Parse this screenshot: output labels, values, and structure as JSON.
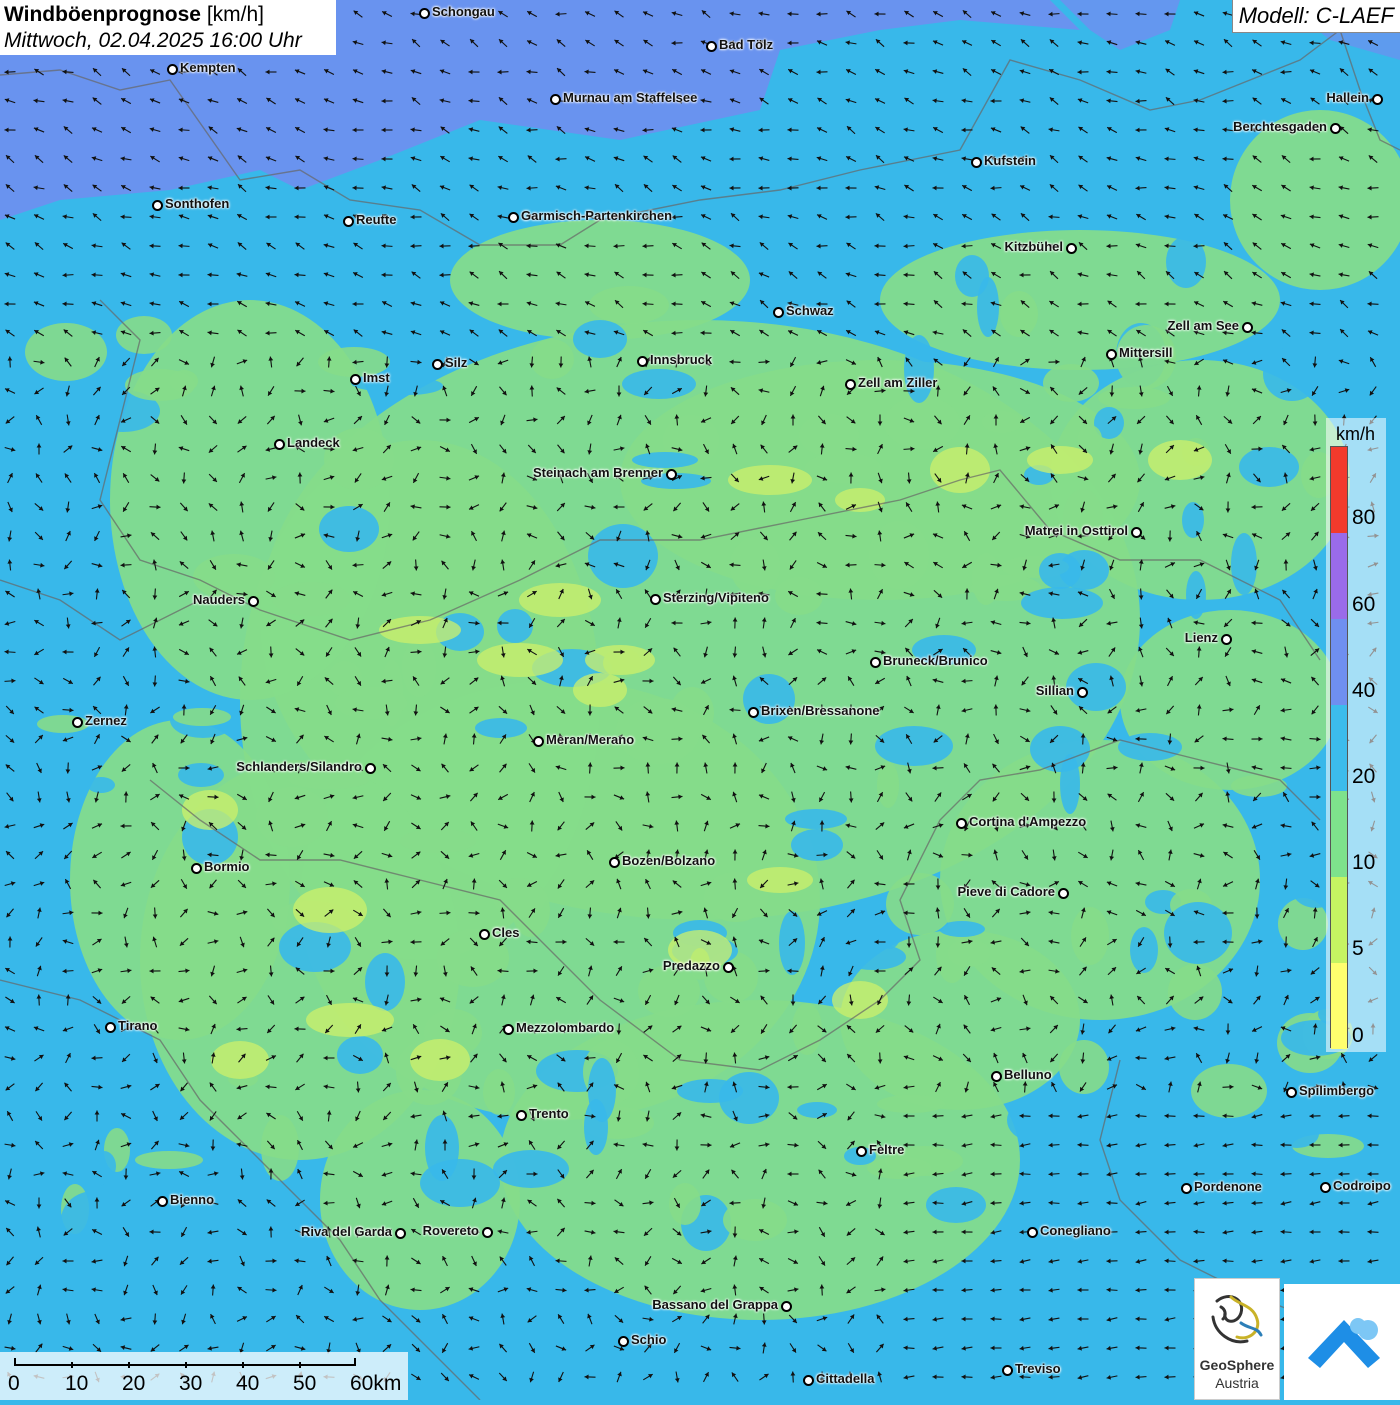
{
  "title": {
    "main_bold": "Windböenprognose",
    "unit": "[km/h]",
    "datetime": "Mittwoch, 02.04.2025 16:00 Uhr"
  },
  "model": "Modell: C-LAEF",
  "legend": {
    "unit": "km/h",
    "labels": [
      "80",
      "60",
      "40",
      "20",
      "10",
      "5",
      "0"
    ],
    "colors": [
      "#f23a2c",
      "#9a6bea",
      "#6f8ff0",
      "#3cbcec",
      "#7ee28c",
      "#c6f462",
      "#ffff6e"
    ]
  },
  "scalebar": {
    "labels": [
      "0",
      "10",
      "20",
      "30",
      "40",
      "50",
      "60km"
    ]
  },
  "logo": {
    "name_line1": "GeoSphere",
    "name_line2": "Austria"
  },
  "cities": [
    {
      "name": "Schongau"
    },
    {
      "name": "Kempten"
    },
    {
      "name": "Bad Tölz"
    },
    {
      "name": "Murnau am Staffelsee"
    },
    {
      "name": "Hallein"
    },
    {
      "name": "Berchtesgaden"
    },
    {
      "name": "Kufstein"
    },
    {
      "name": "Sonthofen"
    },
    {
      "name": "Reutte"
    },
    {
      "name": "Garmisch-Partenkirchen"
    },
    {
      "name": "Kitzbühel"
    },
    {
      "name": "Schwaz"
    },
    {
      "name": "Zell am See"
    },
    {
      "name": "Mittersill"
    },
    {
      "name": "Innsbruck"
    },
    {
      "name": "Silz"
    },
    {
      "name": "Imst"
    },
    {
      "name": "Zell am Ziller"
    },
    {
      "name": "Landeck"
    },
    {
      "name": "Steinach am Brenner"
    },
    {
      "name": "Matrei in Osttirol"
    },
    {
      "name": "Nauders"
    },
    {
      "name": "Sterzing/Vipiteno"
    },
    {
      "name": "Lienz"
    },
    {
      "name": "Bruneck/Brunico"
    },
    {
      "name": "Sillian"
    },
    {
      "name": "Brixen/Bressanone"
    },
    {
      "name": "Zernez"
    },
    {
      "name": "Meran/Merano"
    },
    {
      "name": "Schlanders/Silandro"
    },
    {
      "name": "Cortina d'Ampezzo"
    },
    {
      "name": "Bozen/Bolzano"
    },
    {
      "name": "Bormio"
    },
    {
      "name": "Pieve di Cadore"
    },
    {
      "name": "Cles"
    },
    {
      "name": "Predazzo"
    },
    {
      "name": "Tirano"
    },
    {
      "name": "Mezzolombardo"
    },
    {
      "name": "Belluno"
    },
    {
      "name": "Spilimbergo"
    },
    {
      "name": "Trento"
    },
    {
      "name": "Feltre"
    },
    {
      "name": "Pordenone"
    },
    {
      "name": "Codroipo"
    },
    {
      "name": "Bienno"
    },
    {
      "name": "Riva del Garda"
    },
    {
      "name": "Rovereto"
    },
    {
      "name": "Conegliano"
    },
    {
      "name": "Bassano del Grappa"
    },
    {
      "name": "Schio"
    },
    {
      "name": "Treviso"
    },
    {
      "name": "Cittadella"
    }
  ]
}
